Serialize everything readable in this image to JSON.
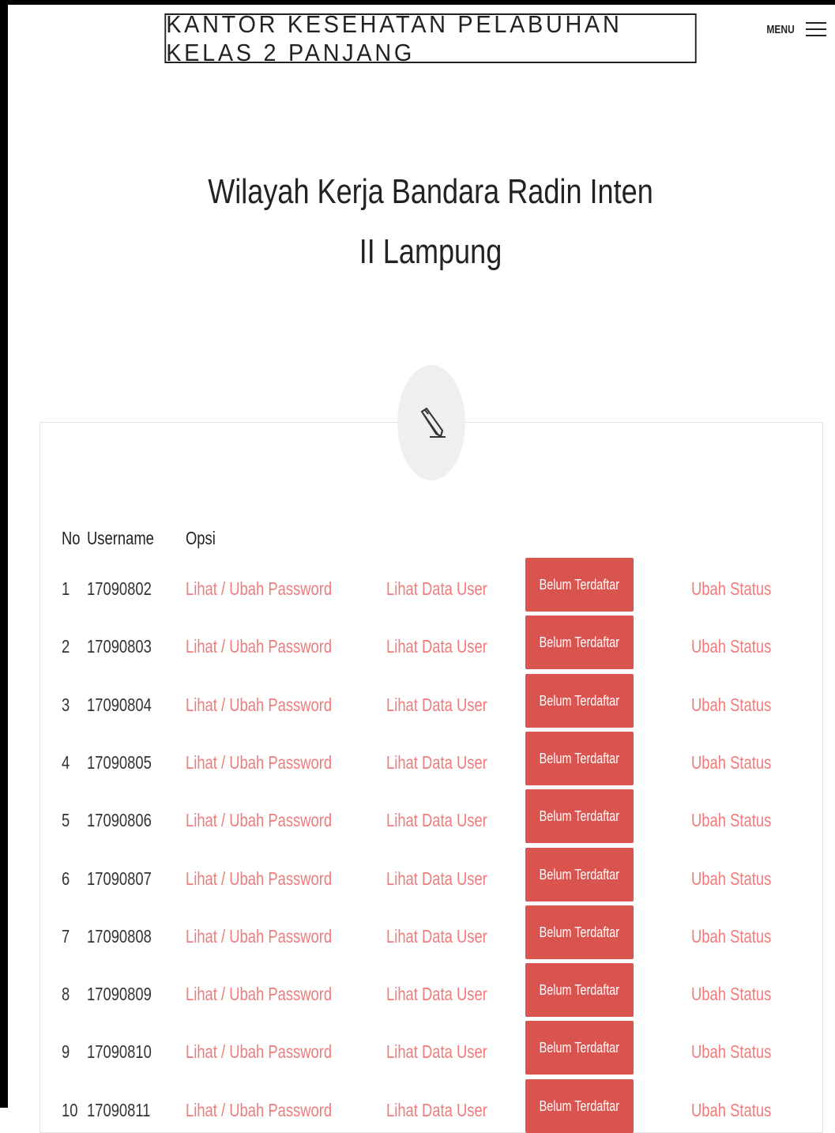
{
  "header": {
    "site_title": "KANTOR KESEHATAN PELABUHAN KELAS 2 PANJANG",
    "menu_label": "MENU",
    "menu_icon": "hamburger-icon"
  },
  "page": {
    "heading_line1": "Wilayah Kerja Bandara Radin Inten",
    "heading_line2": "II Lampung",
    "panel_icon": "pencil-icon"
  },
  "table": {
    "columns": [
      "No",
      "Username",
      "Opsi"
    ],
    "rows": [
      {
        "no": "1",
        "username": "17090802",
        "password_link": "Lihat / Ubah Password",
        "data_link": "Lihat Data User",
        "status_button": "Belum Terdaftar",
        "status_link": "Ubah Status"
      },
      {
        "no": "2",
        "username": "17090803",
        "password_link": "Lihat / Ubah Password",
        "data_link": "Lihat Data User",
        "status_button": "Belum Terdaftar",
        "status_link": "Ubah Status"
      },
      {
        "no": "3",
        "username": "17090804",
        "password_link": "Lihat / Ubah Password",
        "data_link": "Lihat Data User",
        "status_button": "Belum Terdaftar",
        "status_link": "Ubah Status"
      },
      {
        "no": "4",
        "username": "17090805",
        "password_link": "Lihat / Ubah Password",
        "data_link": "Lihat Data User",
        "status_button": "Belum Terdaftar",
        "status_link": "Ubah Status"
      },
      {
        "no": "5",
        "username": "17090806",
        "password_link": "Lihat / Ubah Password",
        "data_link": "Lihat Data User",
        "status_button": "Belum Terdaftar",
        "status_link": "Ubah Status"
      },
      {
        "no": "6",
        "username": "17090807",
        "password_link": "Lihat / Ubah Password",
        "data_link": "Lihat Data User",
        "status_button": "Belum Terdaftar",
        "status_link": "Ubah Status"
      },
      {
        "no": "7",
        "username": "17090808",
        "password_link": "Lihat / Ubah Password",
        "data_link": "Lihat Data User",
        "status_button": "Belum Terdaftar",
        "status_link": "Ubah Status"
      },
      {
        "no": "8",
        "username": "17090809",
        "password_link": "Lihat / Ubah Password",
        "data_link": "Lihat Data User",
        "status_button": "Belum Terdaftar",
        "status_link": "Ubah Status"
      },
      {
        "no": "9",
        "username": "17090810",
        "password_link": "Lihat / Ubah Password",
        "data_link": "Lihat Data User",
        "status_button": "Belum Terdaftar",
        "status_link": "Ubah Status"
      },
      {
        "no": "10",
        "username": "17090811",
        "password_link": "Lihat / Ubah Password",
        "data_link": "Lihat Data User",
        "status_button": "Belum Terdaftar",
        "status_link": "Ubah Status"
      }
    ]
  },
  "colors": {
    "link": "#ef7b7b",
    "status_button_bg": "#d9534f"
  }
}
